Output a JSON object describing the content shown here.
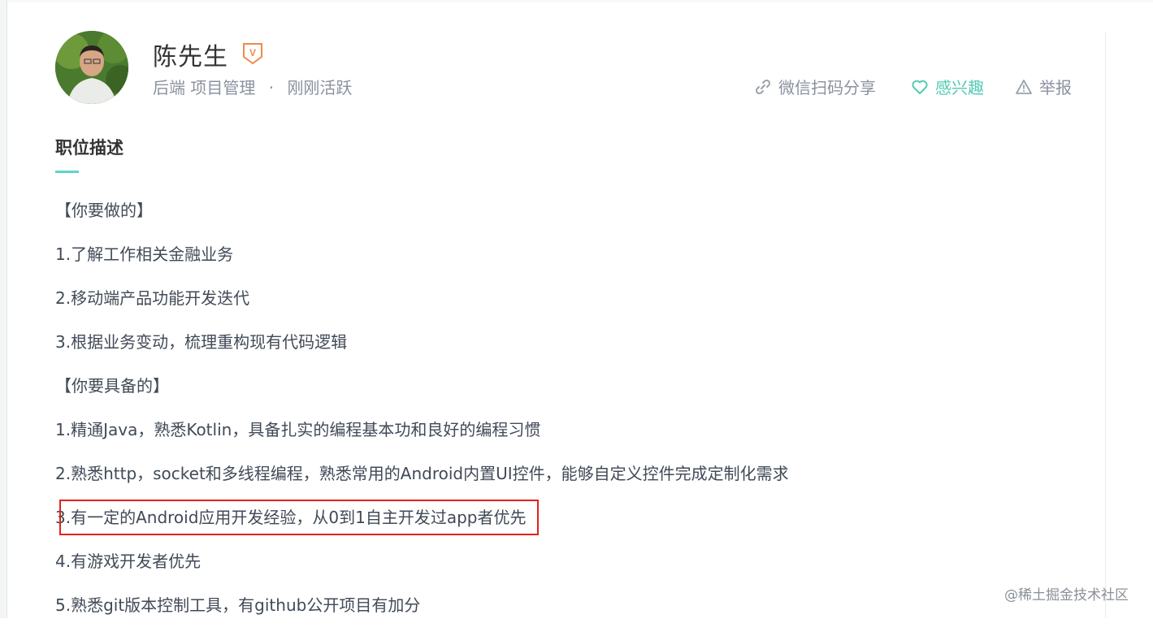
{
  "profile": {
    "name": "陈先生",
    "badge": "V",
    "tags": "后端 项目管理",
    "dot": "·",
    "status": "刚刚活跃"
  },
  "actions": {
    "share": "微信扫码分享",
    "interest": "感兴趣",
    "report": "举报"
  },
  "section": {
    "title": "职位描述"
  },
  "description": [
    "【你要做的】",
    "1.了解工作相关金融业务",
    "2.移动端产品功能开发迭代",
    "3.根据业务变动，梳理重构现有代码逻辑",
    "【你要具备的】",
    "1.精通Java，熟悉Kotlin，具备扎实的编程基本功和良好的编程习惯",
    "2.熟悉http，socket和多线程编程，熟悉常用的Android内置UI控件，能够自定义控件完成定制化需求",
    "3.有一定的Android应用开发经验，从0到1自主开发过app者优先",
    "4.有游戏开发者优先",
    "5.熟悉git版本控制工具，有github公开项目有加分"
  ],
  "watermark": "@稀土掘金技术社区",
  "colors": {
    "accent": "#55cbb4",
    "underline": "#5dd5c8",
    "highlight": "#e2231a",
    "badge": "#f08a4b",
    "muted": "#8a919f"
  },
  "icons": {
    "share": "link-icon",
    "interest": "heart-icon",
    "report": "warning-icon",
    "badge": "verified-v-icon"
  }
}
